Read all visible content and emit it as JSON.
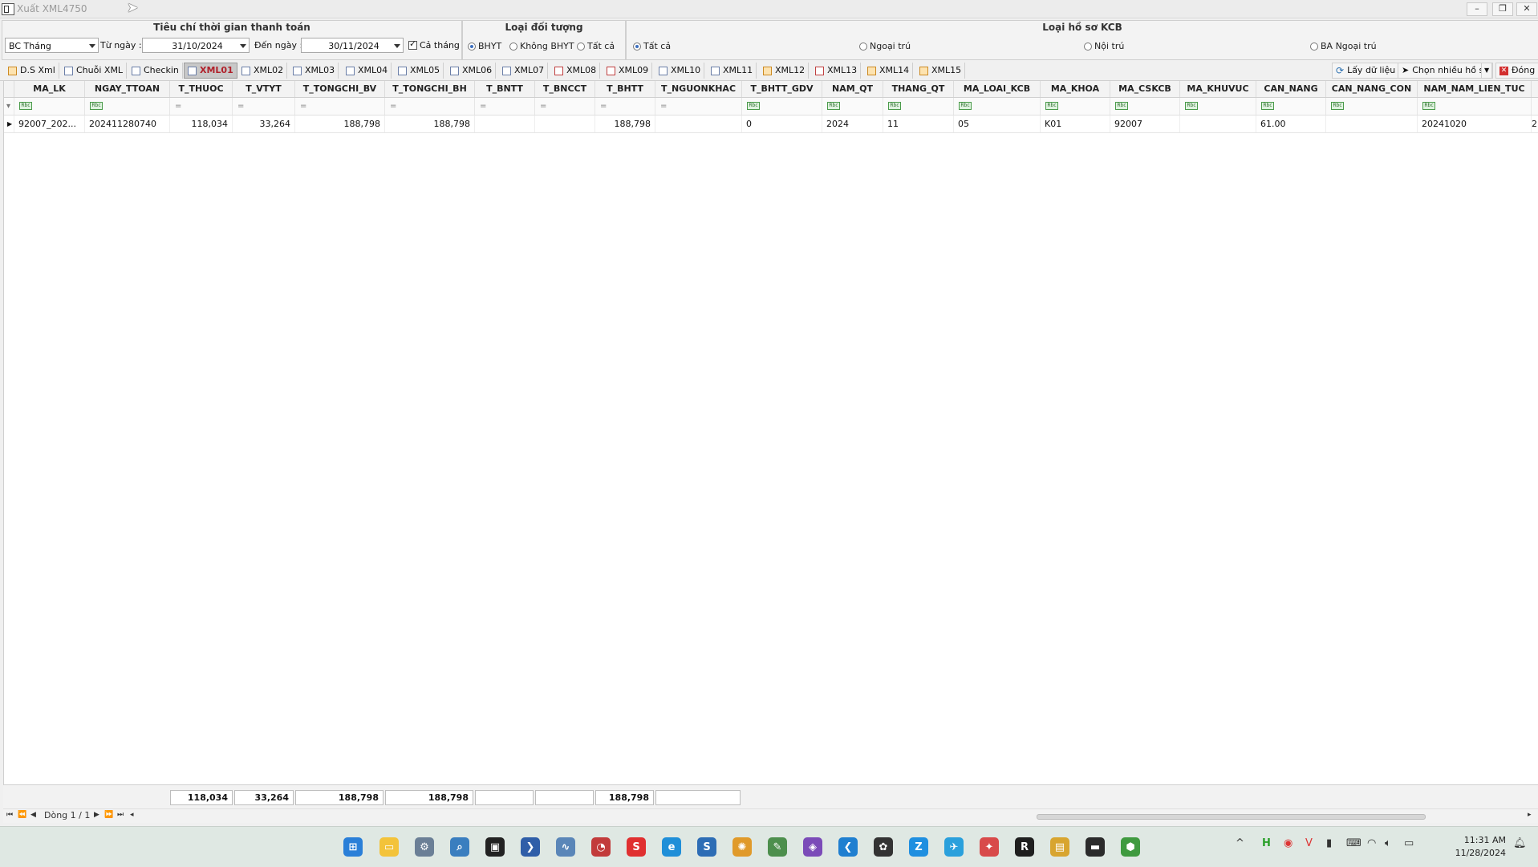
{
  "window": {
    "title": "Xuất XML4750",
    "min": "–",
    "restore": "❐",
    "close": "✕"
  },
  "criteria": {
    "time_group_title": "Tiêu chí thời gian thanh toán",
    "report_type": "BC Tháng",
    "from_label": "Từ ngày :",
    "from_value": "31/10/2024",
    "to_label": "Đến ngày :",
    "to_value": "30/11/2024",
    "whole_month_label": "Cả tháng",
    "object_group_title": "Loại đối tượng",
    "object_options": [
      "BHYT",
      "Không BHYT",
      "Tất cả"
    ],
    "record_group_title": "Loại hồ sơ KCB",
    "record_options": [
      "Tất cả",
      "Ngoại trú",
      "Nội trú",
      "BA Ngoại trú"
    ]
  },
  "tabs": [
    {
      "label": "D.S Xml"
    },
    {
      "label": "Chuỗi XML"
    },
    {
      "label": "Checkin"
    },
    {
      "label": "XML01"
    },
    {
      "label": "XML02"
    },
    {
      "label": "XML03"
    },
    {
      "label": "XML04"
    },
    {
      "label": "XML05"
    },
    {
      "label": "XML06"
    },
    {
      "label": "XML07"
    },
    {
      "label": "XML08"
    },
    {
      "label": "XML09"
    },
    {
      "label": "XML10"
    },
    {
      "label": "XML11"
    },
    {
      "label": "XML12"
    },
    {
      "label": "XML13"
    },
    {
      "label": "XML14"
    },
    {
      "label": "XML15"
    }
  ],
  "actions": {
    "fetch": "Lấy dữ liệu",
    "multi": "Chọn nhiều hồ sơ",
    "close": "Đóng"
  },
  "grid": {
    "columns": [
      "MA_LK",
      "NGAY_TTOAN",
      "T_THUOC",
      "T_VTYT",
      "T_TONGCHI_BV",
      "T_TONGCHI_BH",
      "T_BNTT",
      "T_BNCCT",
      "T_BHTT",
      "T_NGUONKHAC",
      "T_BHTT_GDV",
      "NAM_QT",
      "THANG_QT",
      "MA_LOAI_KCB",
      "MA_KHOA",
      "MA_CSKCB",
      "MA_KHUVUC",
      "CAN_NANG",
      "CAN_NANG_CON",
      "NAM_NAM_LIEN_TUC"
    ],
    "filter_rbc": "Rbc",
    "filter_eq": "=",
    "row": [
      "92007_202...",
      "202411280740",
      "118,034",
      "33,264",
      "188,798",
      "188,798",
      "",
      "",
      "188,798",
      "",
      "0",
      "2024",
      "11",
      "05",
      "K01",
      "92007",
      "",
      "61.00",
      "",
      "20241020"
    ],
    "row_overflow": "2"
  },
  "totals": {
    "t_thuoc": "118,034",
    "t_vtyt": "33,264",
    "t_tongchi_bv": "188,798",
    "t_tongchi_bh": "188,798",
    "t_bhtt": "188,798"
  },
  "nav": {
    "record_text": "Dòng 1 / 1"
  },
  "clock": {
    "time": "11:31 AM",
    "date": "11/28/2024"
  }
}
